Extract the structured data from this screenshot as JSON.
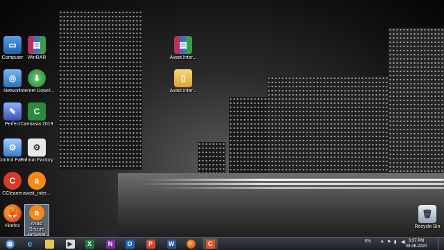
{
  "desktop_icons": {
    "computer": "Computer",
    "winrar": "WinRAR",
    "avast_inter_1": "Avast.Inter...",
    "network": "Network",
    "internet_dl": "Internet Downl...",
    "avast_inter_2": "Avast.Inter...",
    "perfect": "Perfect",
    "camtasia": "Camtasia 2019",
    "control_panel": "Control Panel",
    "format_factory": "Format Factory",
    "ccleaner": "CCleaner",
    "avast_inter_3": "avast_inter...",
    "firefox": "Firefox",
    "avast_secure": "Avast Secure Browser",
    "recycle_bin": "Recycle Bin"
  },
  "tray": {
    "language": "EN",
    "time": "3:37 PM",
    "date": "09-06-2020"
  },
  "icon_names": [
    "windows-icon",
    "ie-icon",
    "explorer-icon",
    "media-icon",
    "excel-icon",
    "onenote-icon",
    "outlook-icon",
    "powerpoint-icon",
    "word-icon",
    "firefox-icon",
    "avast-browser-icon"
  ]
}
